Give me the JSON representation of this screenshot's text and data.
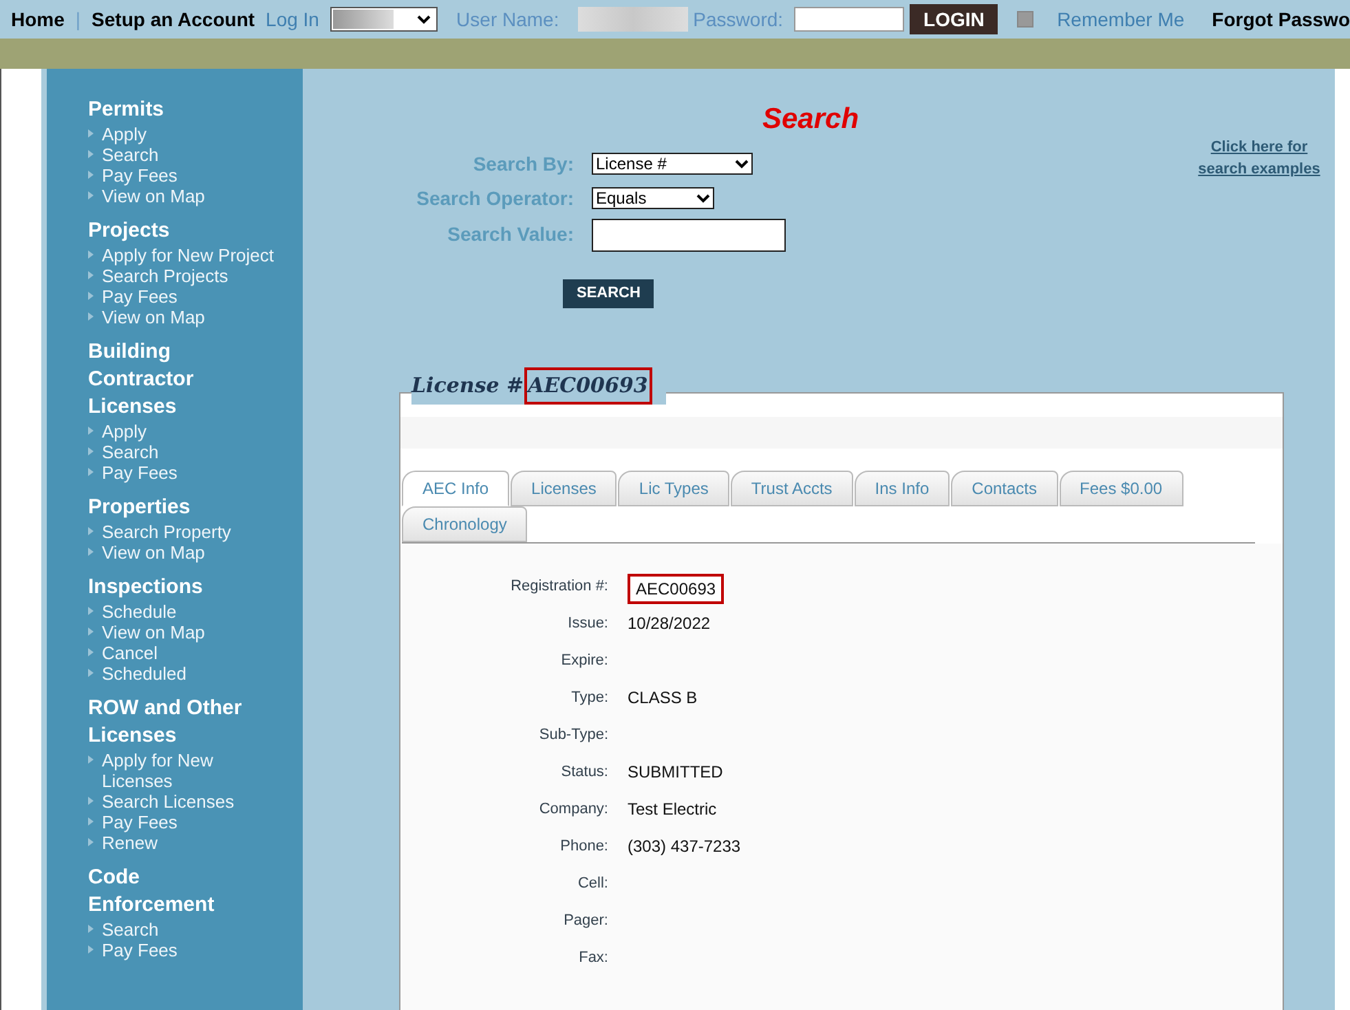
{
  "top_bar": {
    "home": "Home",
    "separator": "|",
    "setup": "Setup an Account",
    "login_label": "Log In",
    "user_name_label": "User Name:",
    "password_label": "Password:",
    "login_button": "LOGIN",
    "remember": {
      "label": "Remember Me",
      "checked": false
    },
    "forgot": "Forgot Passwo"
  },
  "sidebar": [
    {
      "title": "Permits",
      "items": [
        "Apply",
        "Search",
        "Pay Fees",
        "View on Map"
      ]
    },
    {
      "title": "Projects",
      "items": [
        "Apply for New Project",
        "Search Projects",
        "Pay Fees",
        "View on Map"
      ]
    },
    {
      "title": "Building Contractor Licenses",
      "items": [
        "Apply",
        "Search",
        "Pay Fees"
      ]
    },
    {
      "title": "Properties",
      "items": [
        "Search Property",
        "View on Map"
      ]
    },
    {
      "title": "Inspections",
      "items": [
        "Schedule",
        "View on Map",
        "Cancel",
        "Scheduled"
      ]
    },
    {
      "title": "ROW and Other Licenses",
      "items": [
        "Apply for New Licenses",
        "Search Licenses",
        "Pay Fees",
        "Renew"
      ]
    },
    {
      "title": "Code Enforcement",
      "items": [
        "Search",
        "Pay Fees"
      ]
    }
  ],
  "search": {
    "title": "Search",
    "examples_link": "Click here for search examples",
    "fields": [
      {
        "label": "Search By:",
        "kind": "select",
        "value": "License #"
      },
      {
        "label": "Search Operator:",
        "kind": "select",
        "value": "Equals"
      },
      {
        "label": "Search Value:",
        "kind": "text"
      }
    ],
    "button": "SEARCH"
  },
  "license": {
    "title_prefix": "License #",
    "number": "AEC00693",
    "tabs": [
      {
        "label": "AEC Info",
        "selected": true
      },
      {
        "label": "Licenses",
        "selected": false
      },
      {
        "label": "Lic Types",
        "selected": false
      },
      {
        "label": "Trust Accts",
        "selected": false
      },
      {
        "label": "Ins Info",
        "selected": false
      },
      {
        "label": "Contacts",
        "selected": false
      },
      {
        "label": "Fees $0.00",
        "selected": false
      },
      {
        "label": "Chronology",
        "selected": false
      }
    ],
    "fields": [
      {
        "label": "Registration #:",
        "value": "AEC00693",
        "highlighted": true
      },
      {
        "label": "Issue:",
        "value": "10/28/2022"
      },
      {
        "label": "Expire:"
      },
      {
        "label": "Type:",
        "value": "CLASS B"
      },
      {
        "label": "Sub-Type:"
      },
      {
        "label": "Status:",
        "value": "SUBMITTED"
      },
      {
        "label": "Company:",
        "value": "Test Electric"
      },
      {
        "label": "Phone:",
        "value": "(303) 437-7233"
      },
      {
        "label": "Cell:"
      },
      {
        "label": "Pager:"
      },
      {
        "label": "Fax:"
      }
    ]
  }
}
